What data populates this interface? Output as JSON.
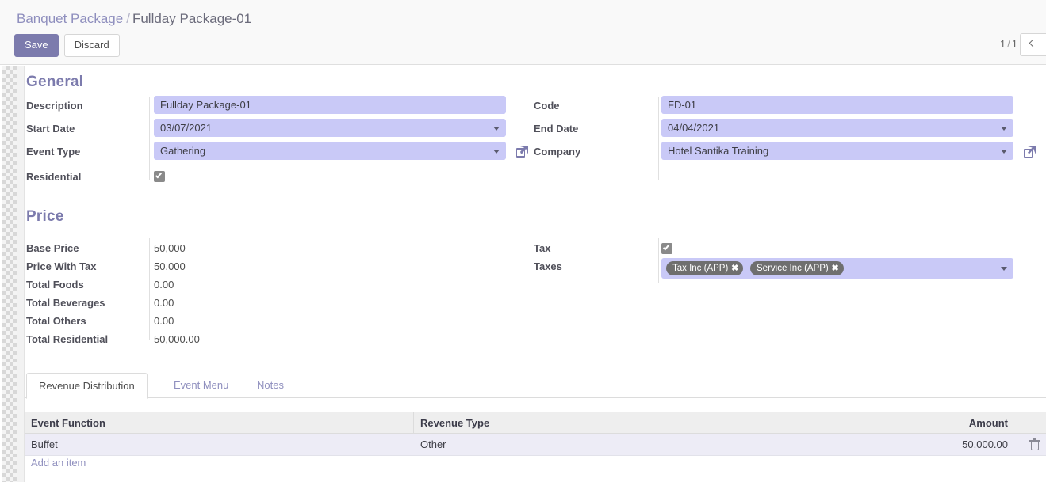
{
  "breadcrumb": {
    "parent": "Banquet Package",
    "separator": "/",
    "current": "Fullday Package-01"
  },
  "toolbar": {
    "save_label": "Save",
    "discard_label": "Discard"
  },
  "pager": {
    "current": "1",
    "separator": "/",
    "total": "1",
    "prev_icon": "chevron-left-icon"
  },
  "sections": {
    "general": {
      "title": "General",
      "left_fields": [
        {
          "label": "Description",
          "value": "Fullday Package-01",
          "type": "text"
        },
        {
          "label": "Start Date",
          "value": "03/07/2021",
          "type": "select"
        },
        {
          "label": "Event Type",
          "value": "Gathering",
          "type": "select"
        },
        {
          "label": "Residential",
          "value": "",
          "type": "checkbox",
          "checked": true
        }
      ],
      "right_fields": [
        {
          "label": "Code",
          "value": "FD-01",
          "type": "text"
        },
        {
          "label": "End Date",
          "value": "04/04/2021",
          "type": "select"
        },
        {
          "label": "Company",
          "value": "Hotel Santika Training",
          "type": "select"
        }
      ],
      "icons": {
        "company_label_link": "external-link-icon",
        "event_type_link": "external-link-icon",
        "company_value_link": "external-link-icon"
      }
    },
    "price": {
      "title": "Price",
      "left_fields": [
        {
          "label": "Base Price",
          "value": "50,000"
        },
        {
          "label": "Price With Tax",
          "value": "50,000"
        },
        {
          "label": "Total Foods",
          "value": "0.00"
        },
        {
          "label": "Total Beverages",
          "value": "0.00"
        },
        {
          "label": "Total Others",
          "value": "0.00"
        },
        {
          "label": "Total Residential",
          "value": "50,000.00"
        }
      ],
      "right_fields": [
        {
          "label": "Tax",
          "type": "checkbox",
          "checked": true
        },
        {
          "label": "Taxes",
          "type": "tags"
        }
      ],
      "tags": [
        {
          "label": "Tax Inc (APP)",
          "remove_icon": "close-icon"
        },
        {
          "label": "Service Inc (APP)",
          "remove_icon": "close-icon"
        }
      ]
    }
  },
  "notebook": {
    "tabs": [
      {
        "label": "Revenue Distribution",
        "active": true
      },
      {
        "label": "Event Menu",
        "active": false
      },
      {
        "label": "Notes",
        "active": false
      }
    ]
  },
  "table": {
    "columns": [
      "Event Function",
      "Revenue Type",
      "Amount"
    ],
    "rows": [
      {
        "event_function": "Buffet",
        "revenue_type": "Other",
        "amount": "50,000.00",
        "delete_icon": "trash-icon"
      }
    ],
    "add_link": "Add an item"
  },
  "colors": {
    "accent": "#7c7bad",
    "field_bg": "#c9c9f7",
    "row_bg": "#edecf6",
    "header_bg": "#eeeeee",
    "tag_bg": "#6f6f6f"
  }
}
